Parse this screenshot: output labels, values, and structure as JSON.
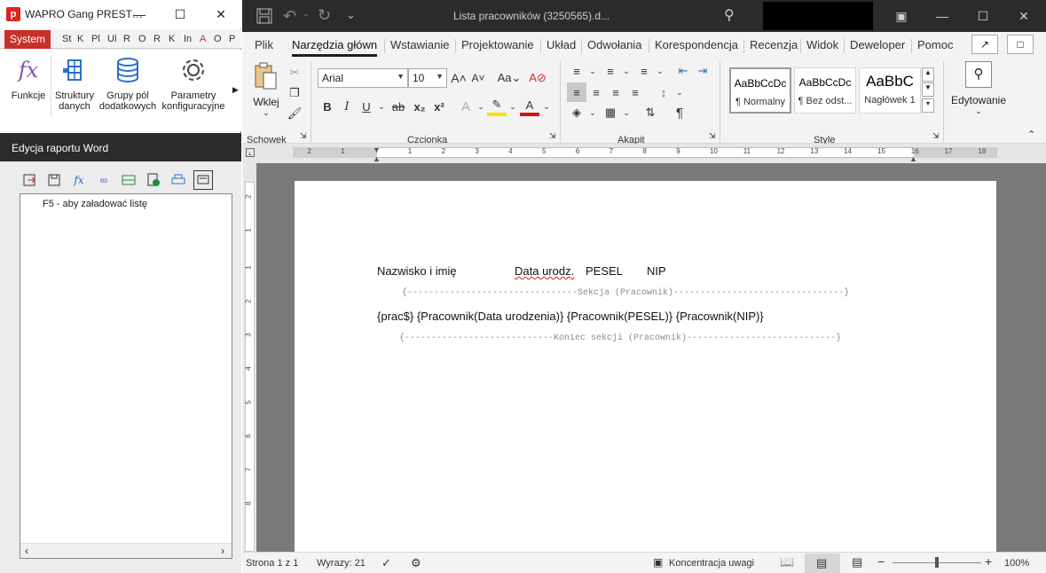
{
  "left_app": {
    "title": "WAPRO Gang PREST…",
    "logo": "p",
    "tabs": [
      "System",
      "St",
      "K",
      "Pl",
      "Ul",
      "R",
      "O",
      "R",
      "K",
      "In",
      "A",
      "O",
      "P"
    ],
    "ribbon": [
      {
        "label": "Funkcje",
        "icon": "fx-icon"
      },
      {
        "label": "Struktury danych",
        "icon": "structure-icon"
      },
      {
        "label": "Grupy pól dodatkowych",
        "icon": "database-icon"
      },
      {
        "label": "Parametry konfiguracyjne",
        "icon": "gear-icon"
      }
    ],
    "panel_title": "Edycja raportu Word",
    "tree_hint": "F5 - aby załadować listę"
  },
  "word": {
    "doc_title": "Lista pracowników (3250565).d...",
    "tabs": [
      "Plik",
      "Narzędzia główn",
      "Wstawianie",
      "Projektowanie",
      "Układ",
      "Odwołania",
      "Korespondencja",
      "Recenzja",
      "Widok",
      "Deweloper",
      "Pomoc"
    ],
    "clipboard": {
      "paste": "Wklej",
      "group": "Schowek"
    },
    "font": {
      "name": "Arial",
      "size": "10",
      "group": "Czcionka"
    },
    "paragraph_group": "Akapit",
    "styles": [
      {
        "sample": "AaBbCcDc",
        "name": "¶ Normalny"
      },
      {
        "sample": "AaBbCcDc",
        "name": "¶ Bez odst..."
      },
      {
        "sample": "AaBbC",
        "name": "Nagłówek 1"
      }
    ],
    "styles_group": "Style",
    "editing": "Edytowanie",
    "ruler_numbers": [
      "2",
      "1",
      "1",
      "2",
      "3",
      "4",
      "5",
      "6",
      "7",
      "8",
      "9",
      "10",
      "11",
      "12",
      "13",
      "14",
      "15",
      "16",
      "17",
      "18"
    ],
    "vruler_numbers": [
      "2",
      "1",
      "1",
      "2",
      "3",
      "4",
      "5",
      "6",
      "7",
      "8"
    ]
  },
  "document": {
    "header_cols": [
      "Nazwisko i imię",
      "Data urodz.",
      "PESEL",
      "NIP"
    ],
    "section_start": "{--------------------------------Sekcja (Pracownik)--------------------------------}",
    "data_row": "{prac$} {Pracownik(Data urodzenia)} {Pracownik(PESEL)} {Pracownik(NIP)}",
    "section_end": "{----------------------------Koniec sekcji (Pracownik)----------------------------}"
  },
  "status": {
    "page": "Strona 1 z 1",
    "words": "Wyrazy: 21",
    "focus": "Koncentracja uwagi",
    "zoom": "100%"
  }
}
